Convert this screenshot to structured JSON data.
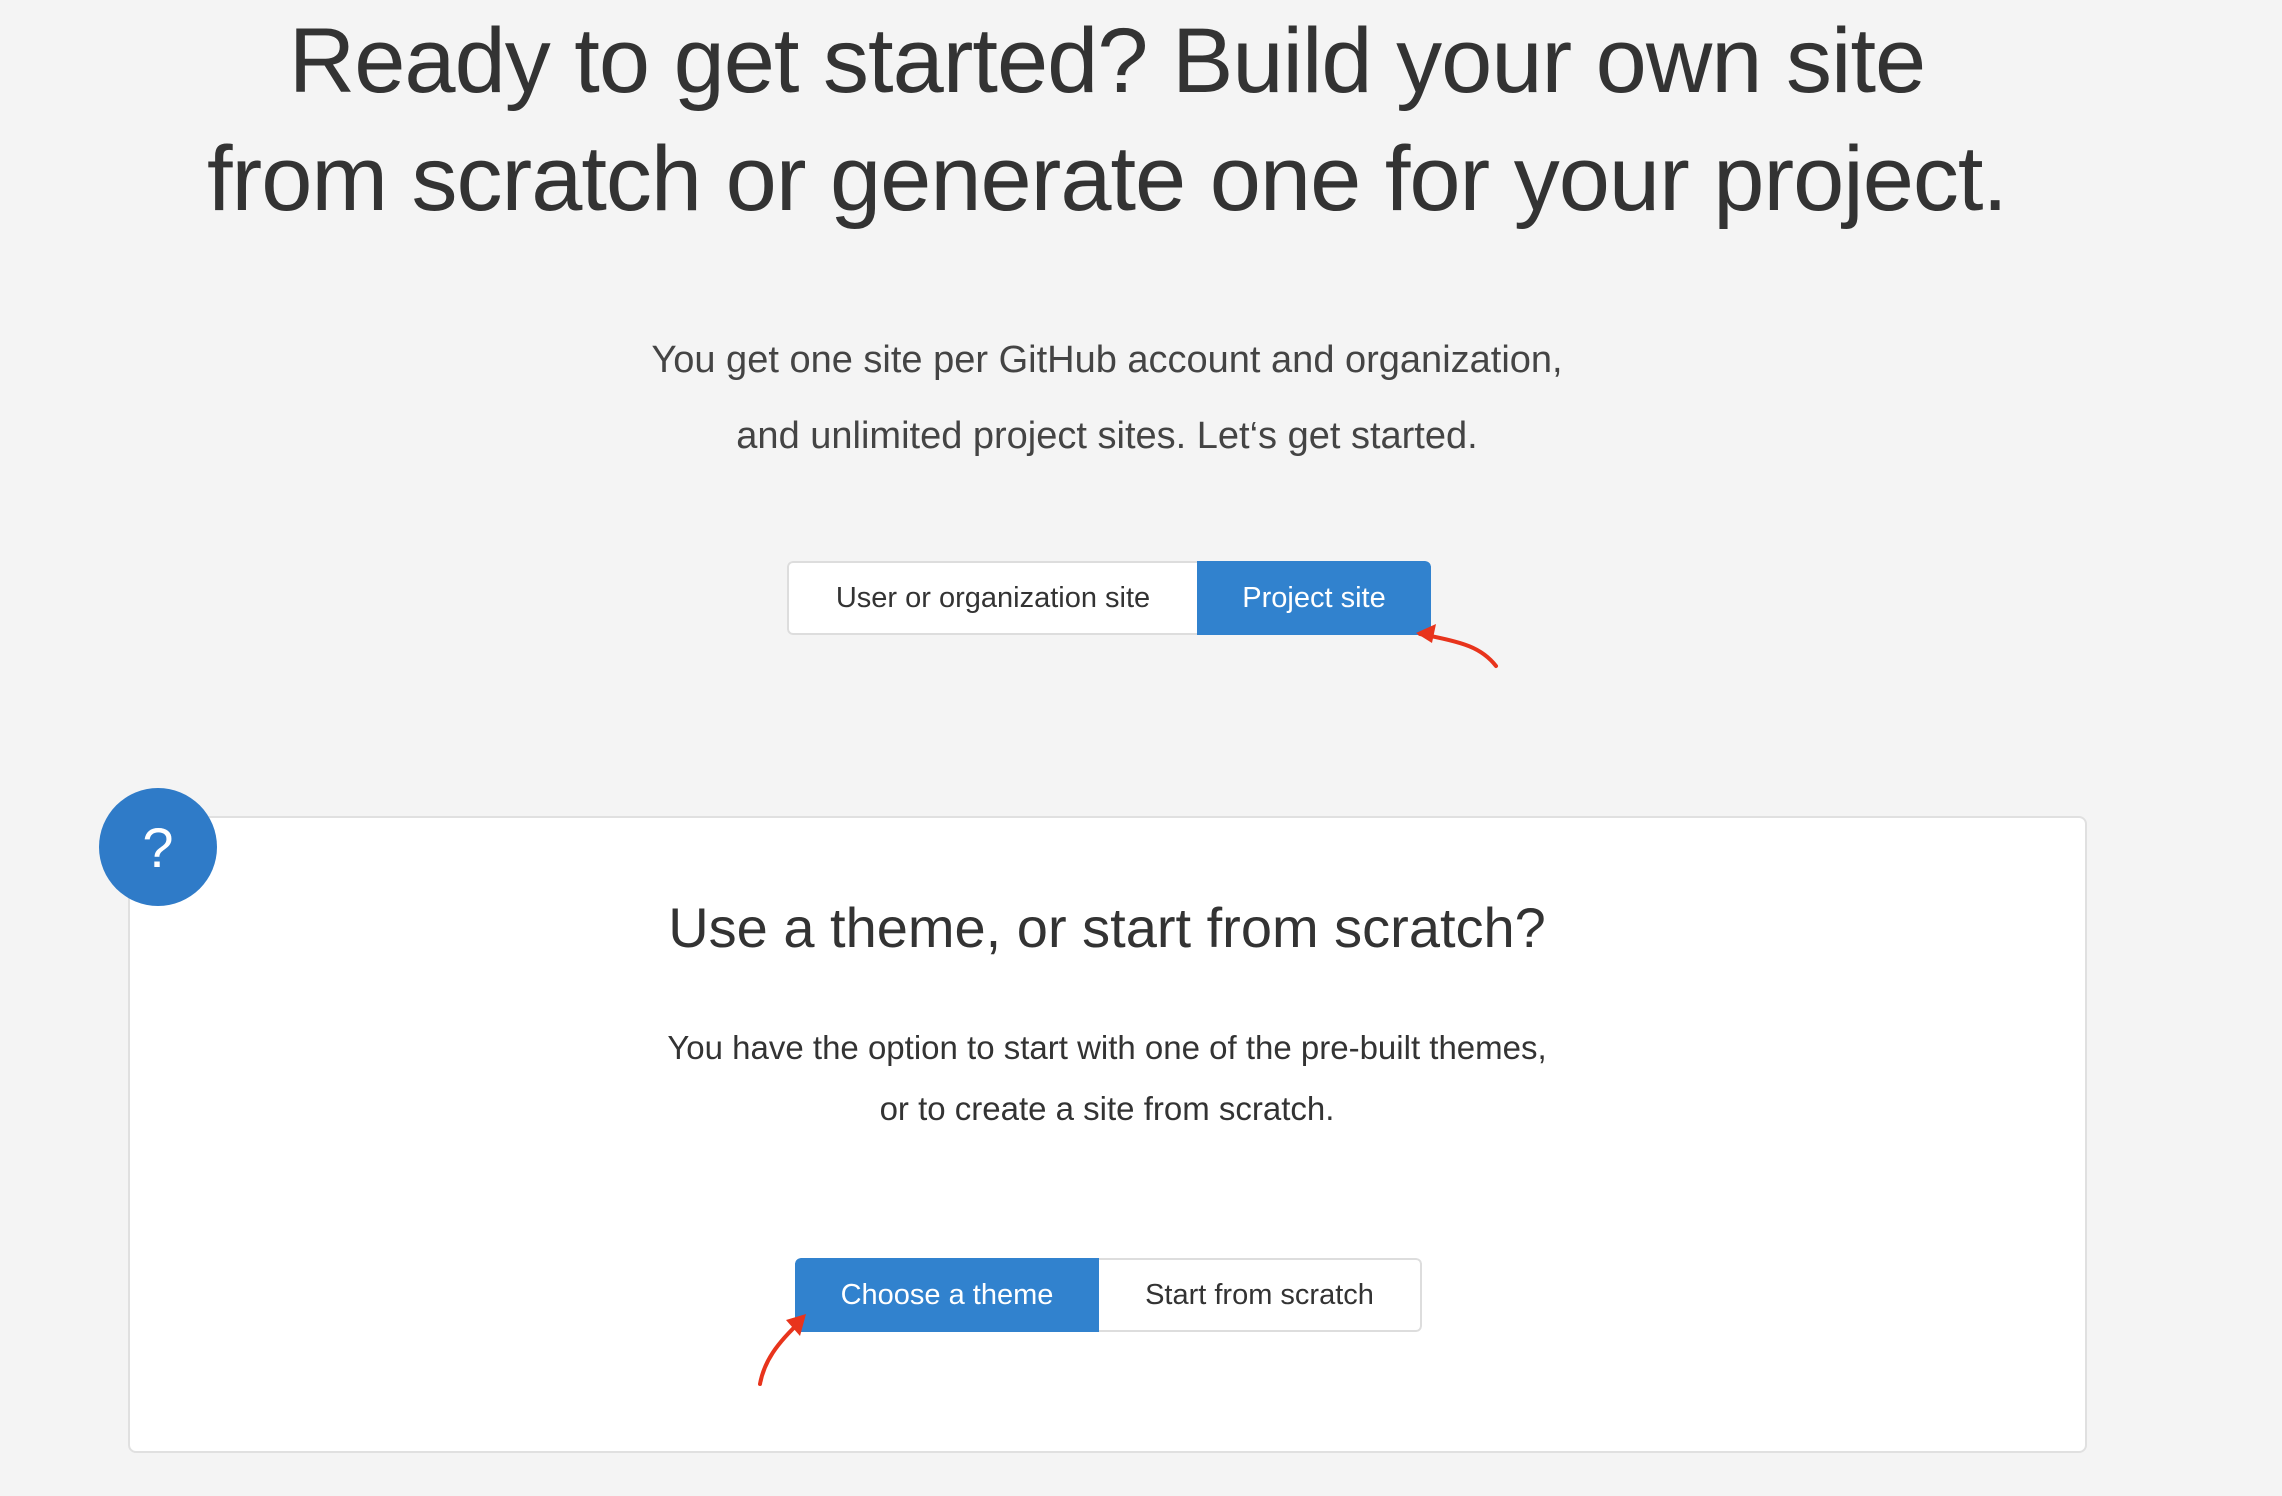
{
  "hero": {
    "title_line1": "Ready to get started? Build your own site",
    "title_line2": "from scratch or generate one for your project.",
    "subtitle_line1": "You get one site per GitHub account and organization,",
    "subtitle_line2": "and unlimited project sites. Let‘s get started."
  },
  "site_type": {
    "options": [
      {
        "label": "User or organization site",
        "selected": false
      },
      {
        "label": "Project site",
        "selected": true
      }
    ]
  },
  "theme_panel": {
    "badge": "?",
    "title": "Use a theme, or start from scratch?",
    "text_line1": "You have the option to start with one of the pre-built themes,",
    "text_line2": "or to create a site from scratch.",
    "options": [
      {
        "label": "Choose a theme",
        "selected": true
      },
      {
        "label": "Start from scratch",
        "selected": false
      }
    ]
  },
  "colors": {
    "accent": "#3182ce",
    "background": "#f4f4f4",
    "annotation_arrow": "#e8341c"
  },
  "annotations": {
    "arrow_icons": [
      "arrow-icon",
      "arrow-icon"
    ]
  }
}
